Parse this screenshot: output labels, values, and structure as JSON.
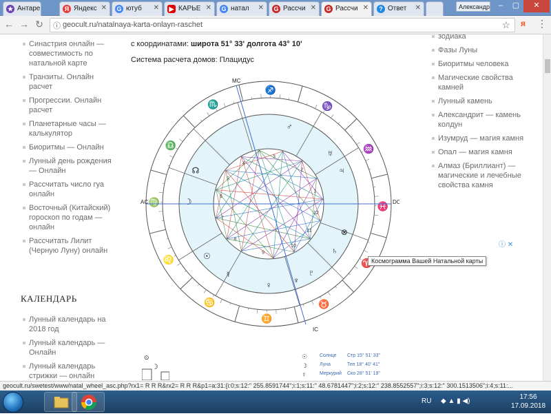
{
  "tabs": [
    {
      "label": "Антаре",
      "icon": "star-icon",
      "color": "#6e3fb5"
    },
    {
      "label": "Яндекс",
      "icon": "yandex-icon",
      "color": "#e53935"
    },
    {
      "label": "ютуб",
      "icon": "google-icon",
      "color": "#4285f4"
    },
    {
      "label": "КАРЬЕ",
      "icon": "youtube-icon",
      "color": "#e00000"
    },
    {
      "label": "натал",
      "icon": "google-icon",
      "color": "#4285f4"
    },
    {
      "label": "Рассчи",
      "icon": "geocult-icon",
      "color": "#c62828"
    },
    {
      "label": "Рассчи",
      "icon": "geocult-icon",
      "color": "#c62828",
      "active": true
    },
    {
      "label": "Ответ",
      "icon": "help-icon",
      "color": "#1e88e5"
    }
  ],
  "user_label": "Александр",
  "url": "geocult.ru/natalnaya-karta-onlayn-raschet",
  "left_links": [
    "Синастрия онлайн — совместимость по натальной карте",
    "Транзиты. Онлайн расчет",
    "Прогрессии. Онлайн расчет",
    "Планетарные часы — калькулятор",
    "Биоритмы — Онлайн",
    "Лунный день рождения — Онлайн",
    "Рассчитать число гуа онлайн",
    "Восточный (Китайский) гороскоп по годам — онлайн",
    "Рассчитать Лилит (Черную Луну) онлайн"
  ],
  "calendar_heading": "КАЛЕНДАРЬ",
  "calendar_links": [
    "Лунный календарь на 2018 год",
    "Лунный календарь — Онлайн",
    "Лунный календарь стрижки — онлайн"
  ],
  "right_links": [
    "зодиака",
    "Фазы Луны",
    "Биоритмы человека",
    "Магические свойства камней",
    "Лунный камень",
    "Александрит — камень колдун",
    "Изумруд — магия камня",
    "Опал — магия камня",
    "Алмаз (Бриллиант) — магические и лечебные свойства камня"
  ],
  "coords_prefix": "с координатами:",
  "coords_value": "широта 51° 33' долгота 43° 10'",
  "house_system": "Система расчета домов: Плацидус",
  "chart": {
    "labels": {
      "mc": "MC",
      "ic": "IC",
      "ac": "AC",
      "dc": "DC"
    },
    "house_numbers": [
      "7",
      "8",
      "9",
      "10",
      "11",
      "12",
      "1",
      "2",
      "3",
      "4",
      "5",
      "6"
    ],
    "signs": [
      "♌",
      "♋",
      "♊",
      "♉",
      "♈",
      "♓",
      "♒",
      "♑",
      "♐",
      "♏",
      "♎",
      "♍"
    ],
    "planets": [
      "♄",
      "⊗",
      "☽",
      "☊",
      "♂",
      "♃",
      "♅",
      "☉",
      "☿",
      "♀",
      "♆",
      "♇"
    ]
  },
  "tooltip": "Космограмма Вашей Натальной карты",
  "legend": [
    {
      "sym": "☉",
      "name": "Солнце",
      "pos": "Стр 15° 51' 33\""
    },
    {
      "sym": "☽",
      "name": "Луна",
      "pos": "Теп 18° 40' 41\""
    },
    {
      "sym": "☿",
      "name": "Меркурий",
      "pos": "Ско 28° 51' 19\""
    }
  ],
  "status_url": "geocult.ru/swetest/www/natal_wheel_asc.php?rx1=    R   R R&rx2=    R   R R&p1=a:31:{i:0;s:12:\" 255.8591744\";i:1;s:11:\" 48.6781447\";i:2;s:12:\" 238.8552557\";i:3;s:12:\" 300.1513506\";i:4;s:11:...",
  "lang": "RU",
  "time": "17:56",
  "date": "17.09.2018",
  "ad_label": "ⓘ ✕"
}
